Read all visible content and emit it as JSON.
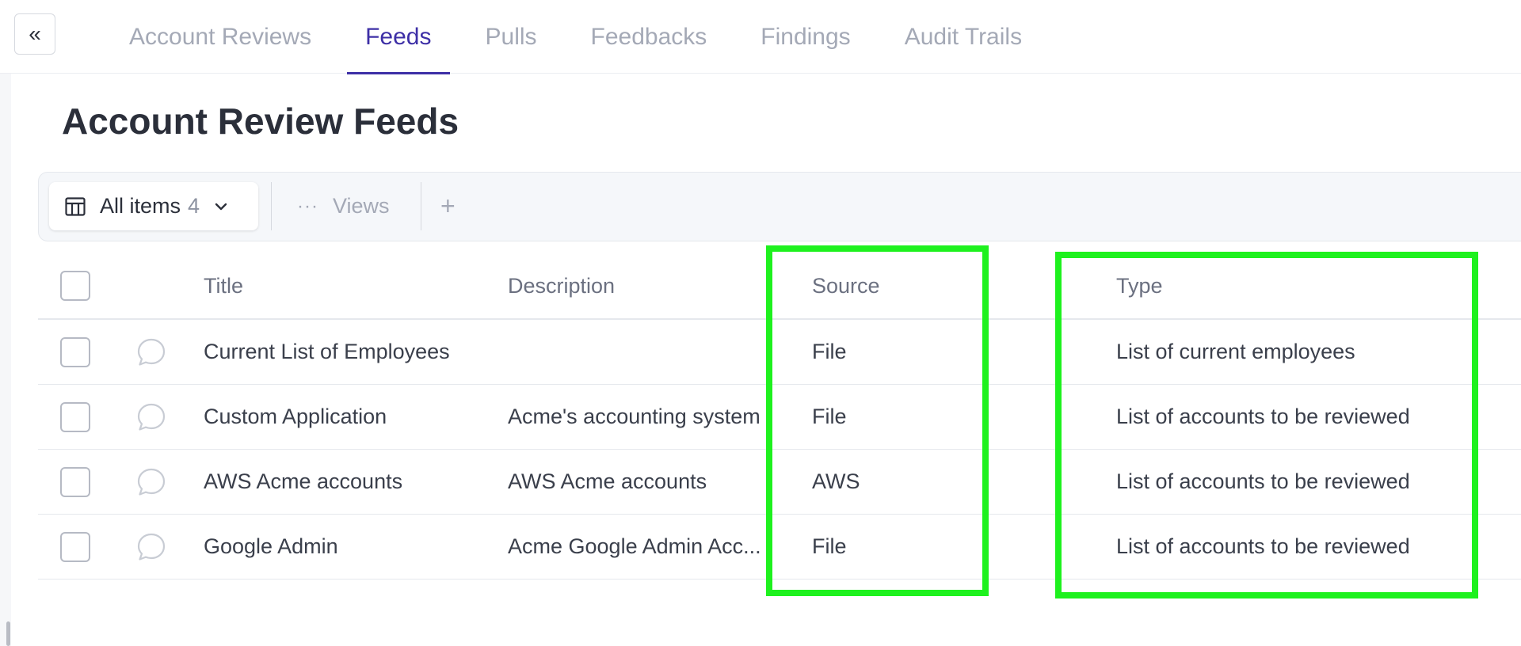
{
  "collapse": {
    "icon": "double-chevron-left-icon",
    "glyph": "«"
  },
  "tabs": [
    {
      "label": "Account Reviews",
      "active": false
    },
    {
      "label": "Feeds",
      "active": true
    },
    {
      "label": "Pulls",
      "active": false
    },
    {
      "label": "Feedbacks",
      "active": false
    },
    {
      "label": "Findings",
      "active": false
    },
    {
      "label": "Audit Trails",
      "active": false
    }
  ],
  "page": {
    "title": "Account Review Feeds"
  },
  "toolbar": {
    "view_label": "All items",
    "view_count": "4",
    "views_label": "Views",
    "add_glyph": "+"
  },
  "table": {
    "columns": {
      "title": "Title",
      "description": "Description",
      "source": "Source",
      "type": "Type"
    },
    "rows": [
      {
        "title": "Current List of Employees",
        "description": "",
        "source": "File",
        "type": "List of current employees"
      },
      {
        "title": "Custom Application",
        "description": "Acme's accounting system",
        "source": "File",
        "type": "List of accounts to be reviewed"
      },
      {
        "title": "AWS Acme accounts",
        "description": "AWS Acme accounts",
        "source": "AWS",
        "type": "List of accounts to be reviewed"
      },
      {
        "title": "Google Admin",
        "description": "Acme Google Admin Acc...",
        "source": "File",
        "type": "List of accounts to be reviewed"
      }
    ]
  },
  "colors": {
    "accent": "#3d2fa6",
    "highlight": "#1ef11e",
    "muted_text": "#a4a9b6"
  }
}
